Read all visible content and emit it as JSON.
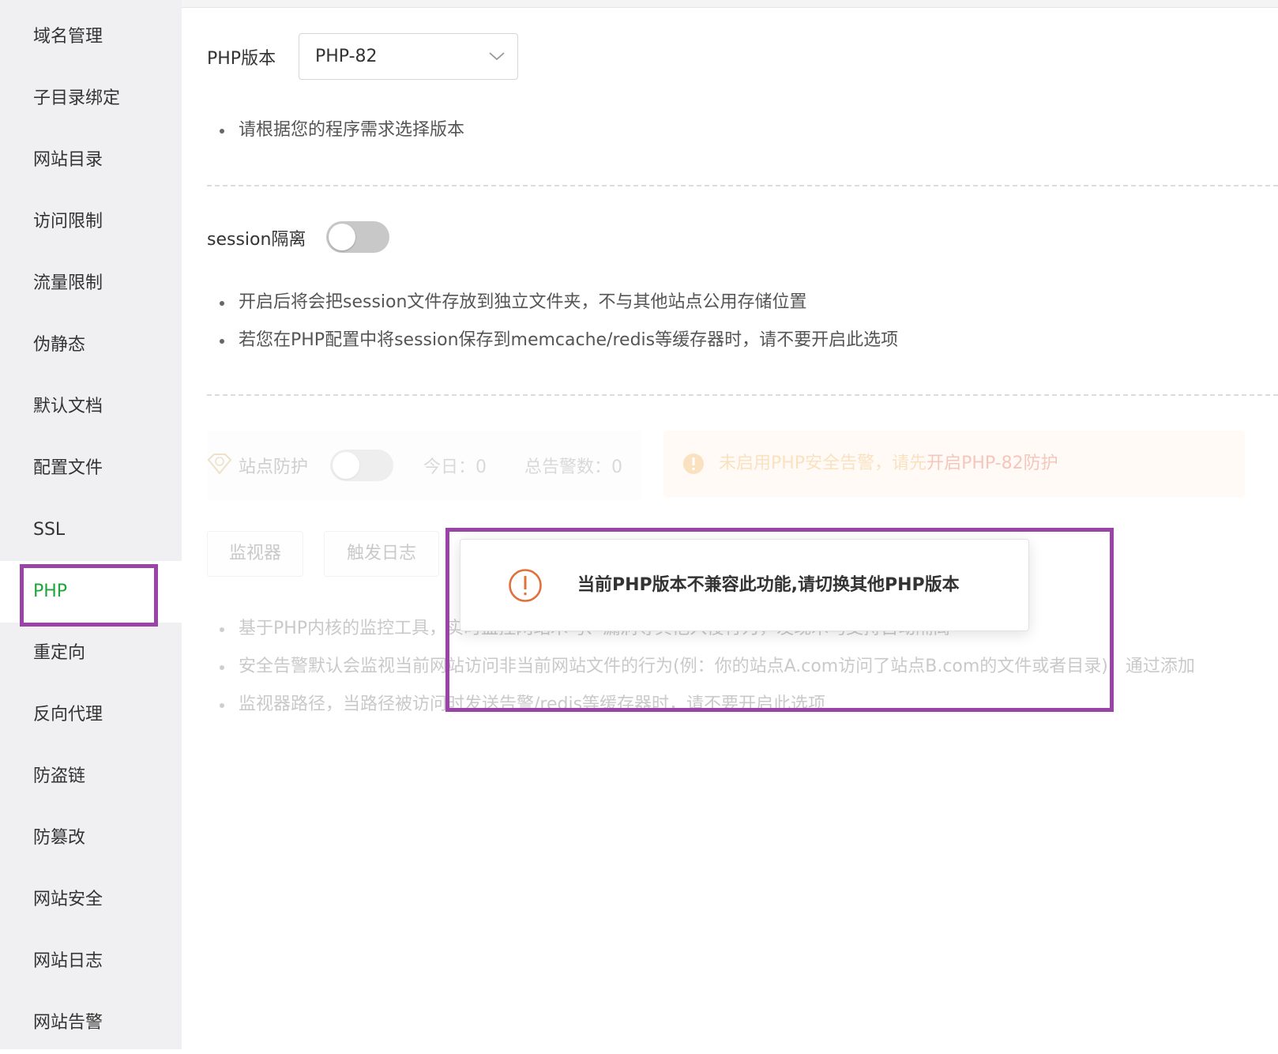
{
  "sidebar": {
    "items": [
      {
        "label": "域名管理"
      },
      {
        "label": "子目录绑定"
      },
      {
        "label": "网站目录"
      },
      {
        "label": "访问限制"
      },
      {
        "label": "流量限制"
      },
      {
        "label": "伪静态"
      },
      {
        "label": "默认文档"
      },
      {
        "label": "配置文件"
      },
      {
        "label": "SSL"
      },
      {
        "label": "PHP"
      },
      {
        "label": "重定向"
      },
      {
        "label": "反向代理"
      },
      {
        "label": "防盗链"
      },
      {
        "label": "防篡改"
      },
      {
        "label": "网站安全"
      },
      {
        "label": "网站日志"
      },
      {
        "label": "网站告警"
      }
    ],
    "active": "PHP"
  },
  "php_version": {
    "label": "PHP版本",
    "selected": "PHP-82",
    "tips": [
      "请根据您的程序需求选择版本"
    ]
  },
  "session": {
    "label": "session隔离",
    "enabled": false,
    "tips": [
      "开启后将会把session文件存放到独立文件夹，不与其他站点公用存储位置",
      "若您在PHP配置中将session保存到memcache/redis等缓存器时，请不要开启此选项"
    ]
  },
  "protection": {
    "label": "站点防护",
    "enabled": false,
    "today_text": "今日：0",
    "total_text": "总告警数：0",
    "alert_prefix": "未启用PHP安全告警，请先",
    "alert_link": "开启PHP-82防护",
    "buttons": {
      "monitor": "监视器",
      "trigger_log": "触发日志"
    },
    "tips": [
      "基于PHP内核的监控工具，实时监控网站木马、漏洞等其他入侵行为，发现木马支持自动隔离",
      "安全告警默认会监视当前网站访问非当前网站文件的行为(例：你的站点A.com访问了站点B.com的文件或者目录)，通过添加",
      "监视器路径，当路径被访问时发送告警/redis等缓存器时，请不要开启此选项"
    ]
  },
  "modal": {
    "message": "当前PHP版本不兼容此功能,请切换其他PHP版本",
    "icon": "exclamation-circle-icon"
  },
  "colors": {
    "active_green": "#20a53a",
    "highlight_purple": "#9b44a8",
    "warn_orange": "#f0a23a",
    "modal_icon": "#e0713b"
  }
}
